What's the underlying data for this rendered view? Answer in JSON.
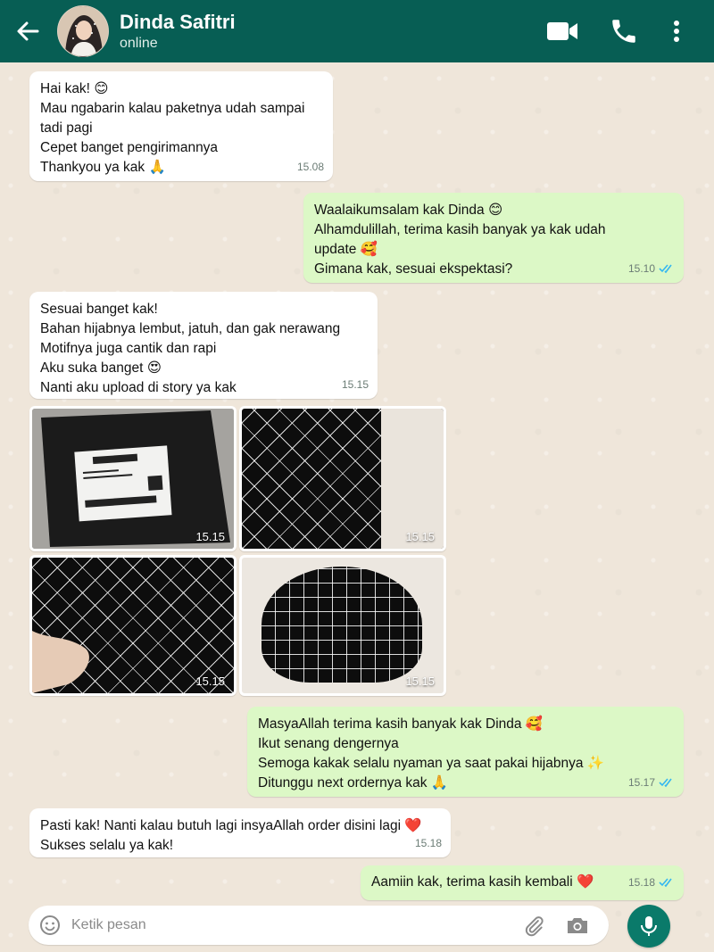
{
  "header": {
    "contact_name": "Dinda Safitri",
    "status": "online",
    "color": "#075e54"
  },
  "messages": [
    {
      "direction": "in",
      "lines": [
        "Hai kak! 😊",
        "Mau ngabarin kalau paketnya udah sampai",
        "tadi pagi",
        "Cepet banget pengirimannya",
        "Thankyou ya kak 🙏"
      ],
      "time": "15.08"
    },
    {
      "direction": "out",
      "lines": [
        "Waalaikumsalam kak Dinda 😊",
        "Alhamdulillah, terima kasih banyak ya kak udah",
        "update 🥰",
        "Gimana kak, sesuai ekspektasi?"
      ],
      "time": "15.10"
    },
    {
      "direction": "in",
      "lines": [
        "Sesuai banget kak!",
        "Bahan hijabnya lembut, jatuh, dan gak nerawang",
        "Motifnya juga cantik dan rapi",
        "Aku suka banget 😍",
        "Nanti aku upload di story ya kak"
      ],
      "time": "15.15"
    },
    {
      "direction": "out",
      "lines": [
        "MasyaAllah terima kasih banyak kak Dinda 🥰",
        "Ikut senang dengernya",
        "Semoga kakak selalu nyaman ya saat pakai hijabnya ✨",
        "Ditunggu next ordernya kak 🙏"
      ],
      "time": "15.17"
    },
    {
      "direction": "in",
      "lines": [
        "Pasti kak! Nanti kalau butuh lagi insyaAllah order disini lagi ❤️",
        "Sukses selalu ya kak!"
      ],
      "time": "15.18"
    },
    {
      "direction": "out",
      "lines": [
        "Aamiin kak, terima kasih kembali ❤️"
      ],
      "time": "15.18"
    }
  ],
  "photos": [
    {
      "subject": "shipping-package",
      "time": "15.15"
    },
    {
      "subject": "hijab-diamond-pattern",
      "time": "15.15"
    },
    {
      "subject": "hijab-ruffle-hand",
      "time": "15.15"
    },
    {
      "subject": "hijab-cap",
      "time": "15.15"
    }
  ],
  "input": {
    "placeholder": "Ketik pesan"
  },
  "colors": {
    "incoming_bubble": "#ffffff",
    "outgoing_bubble": "#dcf8c6",
    "read_ticks": "#34b7f1",
    "mic_button": "#0a7a6a"
  }
}
